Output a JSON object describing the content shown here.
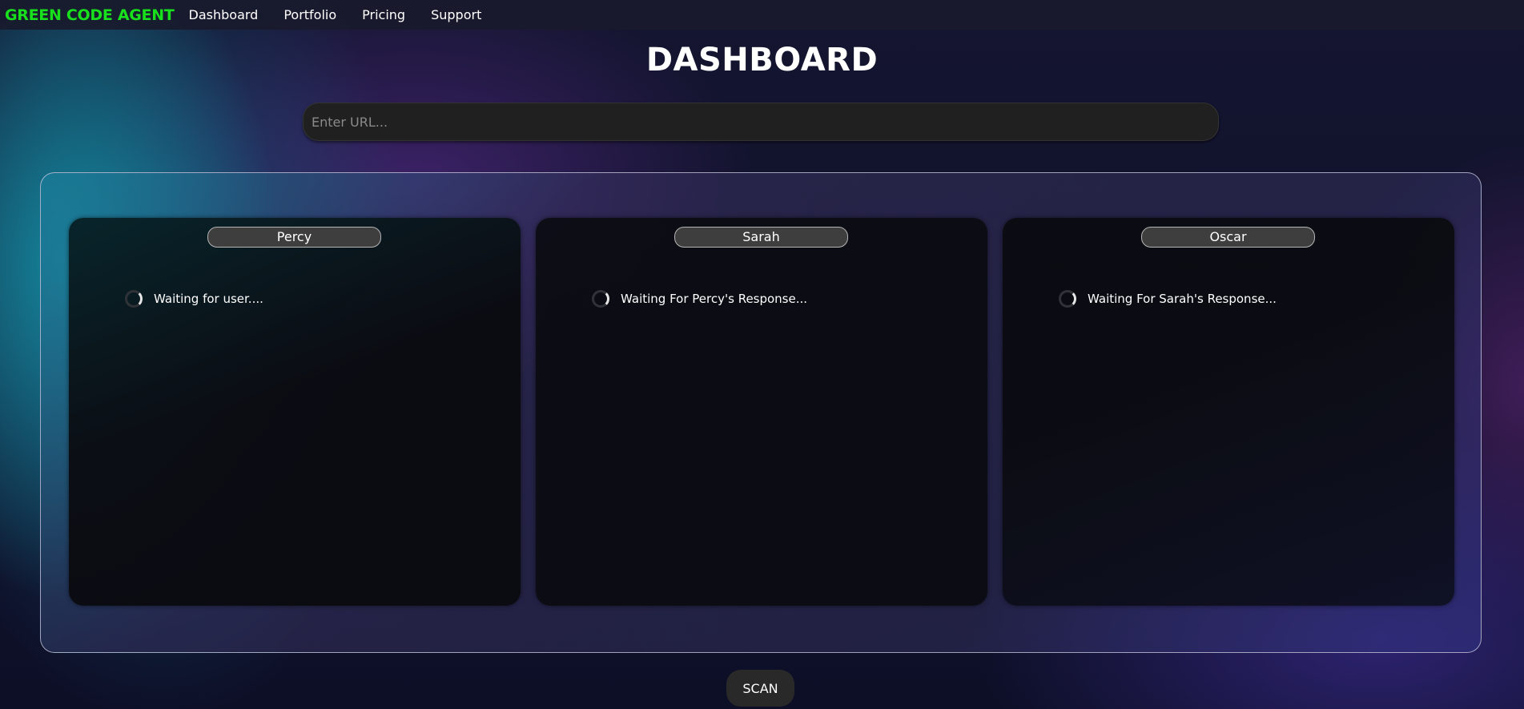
{
  "nav": {
    "brand": "GREEN CODE AGENT",
    "links": [
      "Dashboard",
      "Portfolio",
      "Pricing",
      "Support"
    ]
  },
  "page": {
    "title": "DASHBOARD"
  },
  "url_input": {
    "placeholder": "Enter URL...",
    "value": ""
  },
  "panels": [
    {
      "agent": "Percy",
      "status": "Waiting for user...."
    },
    {
      "agent": "Sarah",
      "status": "Waiting For Percy's Response..."
    },
    {
      "agent": "Oscar",
      "status": "Waiting For Sarah's Response..."
    }
  ],
  "scan_button": {
    "label": "SCAN"
  },
  "colors": {
    "brand": "#19e01c",
    "input_bg": "#202020",
    "panel_bg": "#0a0b10",
    "button_bg": "#292929"
  },
  "icons": {
    "status": "loading-spinner-icon"
  }
}
